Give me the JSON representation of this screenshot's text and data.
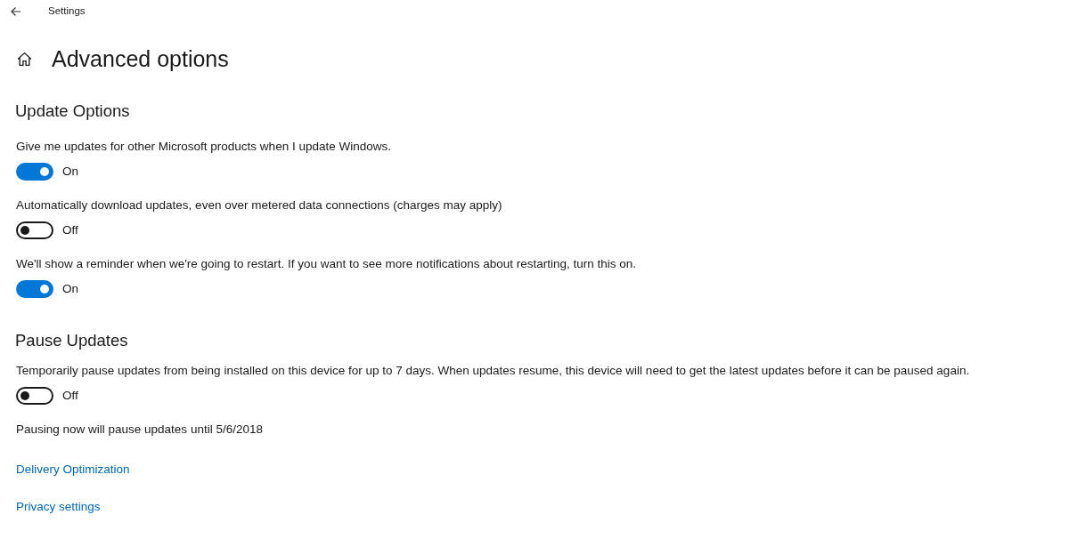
{
  "window": {
    "title": "Settings"
  },
  "page": {
    "title": "Advanced options"
  },
  "sections": [
    {
      "heading": "Update Options",
      "settings": [
        {
          "description": "Give me updates for other Microsoft products when I update Windows.",
          "on": true,
          "state_label": "On"
        },
        {
          "description": "Automatically download updates, even over metered data connections (charges may apply)",
          "on": false,
          "state_label": "Off"
        },
        {
          "description": "We'll show a reminder when we're going to restart. If you want to see more notifications about restarting, turn this on.",
          "on": true,
          "state_label": "On"
        }
      ]
    },
    {
      "heading": "Pause Updates",
      "settings": [
        {
          "description": "Temporarily pause updates from being installed on this device for up to 7 days. When updates resume, this device will need to get the latest updates before it can be paused again.",
          "on": false,
          "state_label": "Off"
        }
      ],
      "note": "Pausing now will pause updates until 5/6/2018"
    }
  ],
  "links": [
    "Delivery Optimization",
    "Privacy settings"
  ]
}
